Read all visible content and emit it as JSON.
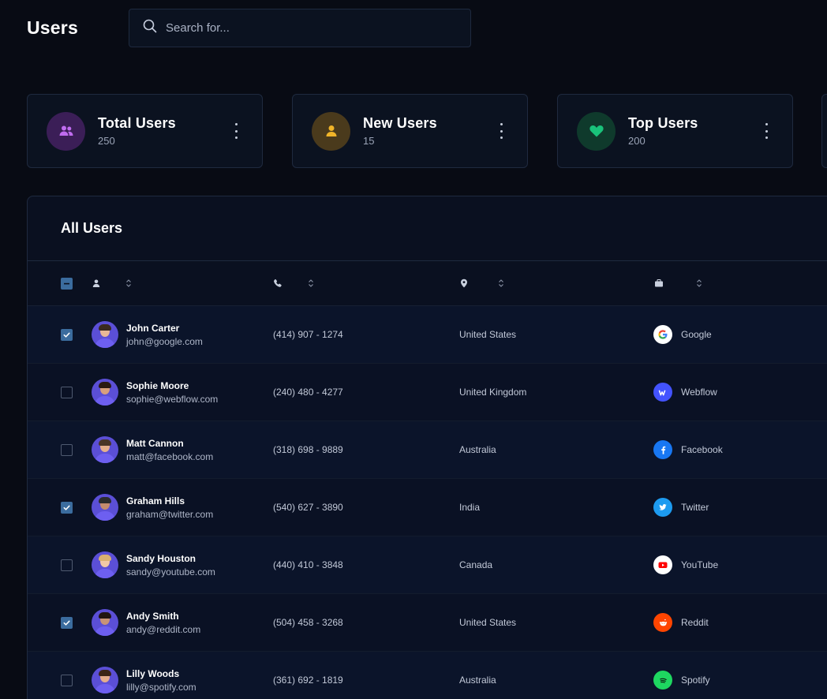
{
  "header": {
    "title": "Users",
    "search_placeholder": "Search for..."
  },
  "stats": [
    {
      "title": "Total Users",
      "value": "250",
      "icon": "users-icon",
      "color": "#b05be6",
      "bg": "#3b1e57"
    },
    {
      "title": "New Users",
      "value": "15",
      "icon": "user-icon",
      "color": "#f0b429",
      "bg": "#4a3a1c"
    },
    {
      "title": "Top Users",
      "value": "200",
      "icon": "heart-icon",
      "color": "#19c27a",
      "bg": "#0f3a2c"
    }
  ],
  "table": {
    "title": "All Users",
    "columns": [
      {
        "icon": "user-icon"
      },
      {
        "icon": "phone-icon"
      },
      {
        "icon": "location-pin-icon"
      },
      {
        "icon": "briefcase-icon"
      }
    ],
    "rows": [
      {
        "checked": true,
        "name": "John Carter",
        "email": "john@google.com",
        "phone": "(414) 907 - 1274",
        "country": "United States",
        "company": "Google",
        "company_icon": "google-icon"
      },
      {
        "checked": false,
        "name": "Sophie Moore",
        "email": "sophie@webflow.com",
        "phone": "(240) 480 - 4277",
        "country": "United Kingdom",
        "company": "Webflow",
        "company_icon": "webflow-icon"
      },
      {
        "checked": false,
        "name": "Matt Cannon",
        "email": "matt@facebook.com",
        "phone": "(318) 698 - 9889",
        "country": "Australia",
        "company": "Facebook",
        "company_icon": "facebook-icon"
      },
      {
        "checked": true,
        "name": "Graham Hills",
        "email": "graham@twitter.com",
        "phone": "(540) 627 - 3890",
        "country": "India",
        "company": "Twitter",
        "company_icon": "twitter-icon"
      },
      {
        "checked": false,
        "name": "Sandy Houston",
        "email": "sandy@youtube.com",
        "phone": "(440) 410 - 3848",
        "country": "Canada",
        "company": "YouTube",
        "company_icon": "youtube-icon"
      },
      {
        "checked": true,
        "name": "Andy Smith",
        "email": "andy@reddit.com",
        "phone": "(504) 458 - 3268",
        "country": "United States",
        "company": "Reddit",
        "company_icon": "reddit-icon"
      },
      {
        "checked": false,
        "name": "Lilly Woods",
        "email": "lilly@spotify.com",
        "phone": "(361) 692 - 1819",
        "country": "Australia",
        "company": "Spotify",
        "company_icon": "spotify-icon"
      }
    ]
  },
  "colors": {
    "background": "#080b14",
    "panel": "#0a1020",
    "border": "#1f2a3f",
    "checkbox_accent": "#3b6c9e",
    "avatar": "#5b4fd6"
  }
}
